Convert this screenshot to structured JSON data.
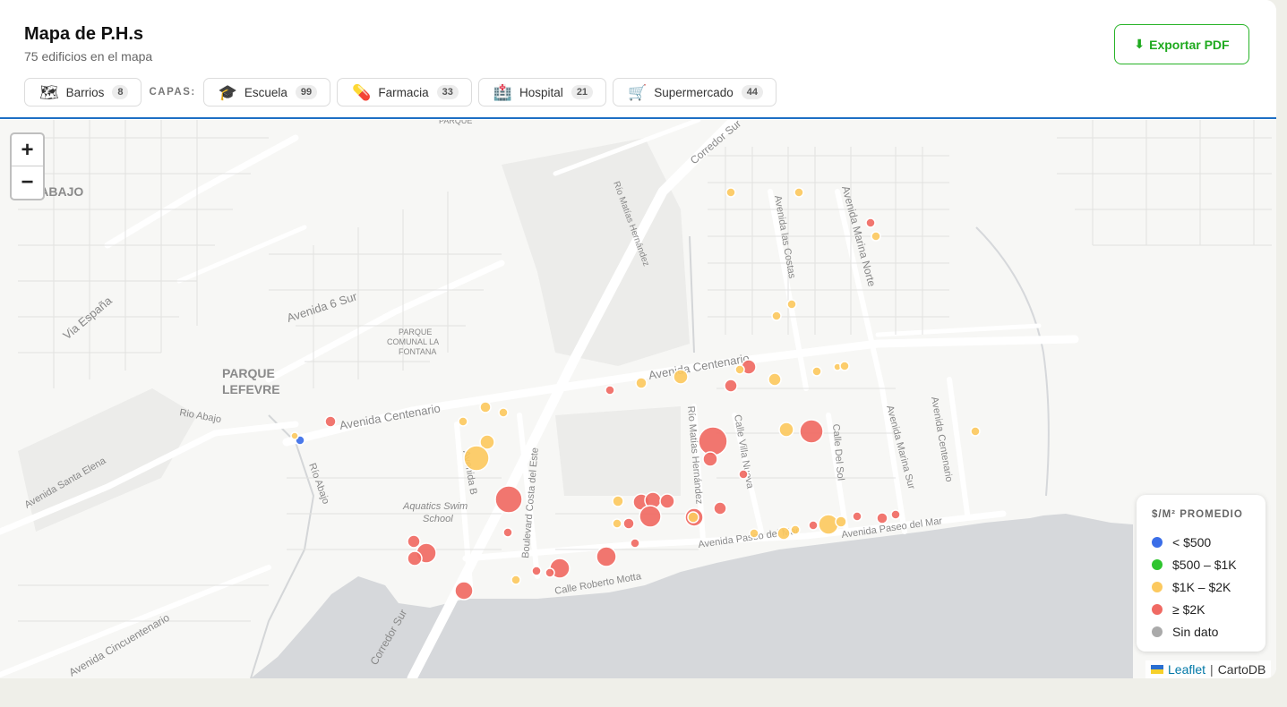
{
  "header": {
    "title": "Mapa de P.H.s",
    "subtitle": "75 edificios en el mapa",
    "export_label": "Exportar PDF"
  },
  "layers": {
    "label": "CAPAS:",
    "barrios": {
      "icon": "map-icon",
      "label": "Barrios",
      "count": "8"
    },
    "items": [
      {
        "icon": "graduation-cap-icon",
        "label": "Escuela",
        "count": "99"
      },
      {
        "icon": "pill-icon",
        "label": "Farmacia",
        "count": "33"
      },
      {
        "icon": "hospital-icon",
        "label": "Hospital",
        "count": "21"
      },
      {
        "icon": "shopping-cart-icon",
        "label": "Supermercado",
        "count": "44"
      }
    ]
  },
  "map": {
    "zoom_in": "+",
    "zoom_out": "−",
    "labels": [
      "O ABAJO",
      "PARQUE",
      "LEFEVRE",
      "Via España",
      "Avenida 6 Sur",
      "PARQUE",
      "COMUNAL LA",
      "FONTANA",
      "Avenida Centenario",
      "Avenida Centenario",
      "Rio Abajo",
      "Río Abajo",
      "Avenida Santa Elena",
      "Avenida B",
      "Aquatics Swim",
      "School",
      "Boulevard Costa del Este",
      "Calle Roberto Motta",
      "Corredor Sur",
      "Corredor Sur",
      "Avenida Cincuentenario",
      "Río Matías Hernández",
      "Río Matías Hernández",
      "Calle Villa Nueva",
      "Calle Del Sol",
      "Avenida Marina Sur",
      "Avenida Marina Norte",
      "Avenida las Costas",
      "Avenida Paseo del Mar",
      "Avenida Paseo del Mar",
      "Avenida Centenario",
      "PARQUE"
    ],
    "colors": {
      "lt500": "#3b6ee8",
      "500to1k": "#2fc52f",
      "1kto2k": "#fcc95f",
      "gte2k": "#f06a63",
      "nodata": "#aaaaaa"
    }
  },
  "legend": {
    "title": "$/M² PROMEDIO",
    "items": [
      {
        "color": "#3b6ee8",
        "label": "< $500"
      },
      {
        "color": "#2fc52f",
        "label": "$500 – $1K"
      },
      {
        "color": "#fcc95f",
        "label": "$1K – $2K"
      },
      {
        "color": "#f06a63",
        "label": "≥ $2K"
      },
      {
        "color": "#aaaaaa",
        "label": "Sin dato"
      }
    ]
  },
  "attribution": {
    "leaflet": "Leaflet",
    "sep": "|",
    "carto": "CartoDB"
  }
}
